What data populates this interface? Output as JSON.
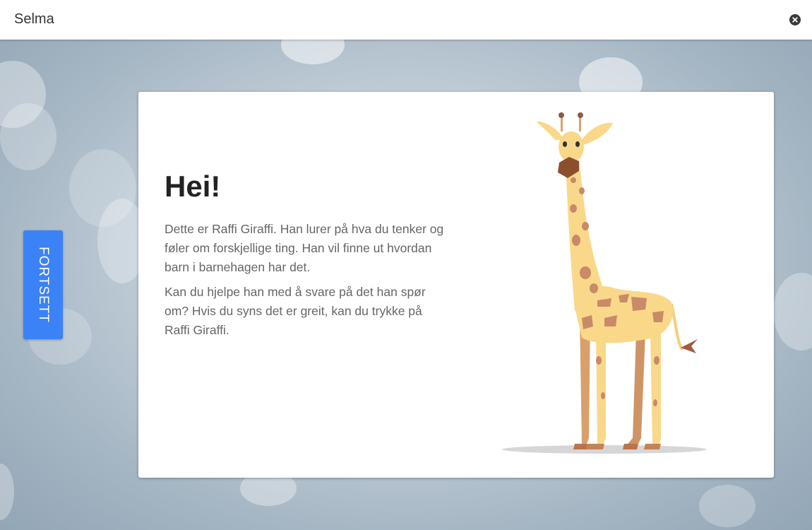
{
  "window": {
    "title": "Selma"
  },
  "colors": {
    "accent": "#3b82f6",
    "card": "#ffffff",
    "heading": "#222222",
    "body_text": "#666666"
  },
  "icons": {
    "close": "close-circle-icon",
    "illustration": "giraffe-illustration"
  },
  "intro": {
    "heading": "Hei!",
    "paragraphs": [
      "Dette er Raffi Giraffi. Han lurer på hva du tenker og føler om forskjellige ting. Han vil finne ut hvordan barn i barnehagen har det.",
      "Kan du hjelpe han med å svare på det han spør om? Hvis du syns det er greit, kan du trykke på Raffi Giraffi."
    ]
  },
  "navigation": {
    "continue_label": "FORTSETT"
  }
}
